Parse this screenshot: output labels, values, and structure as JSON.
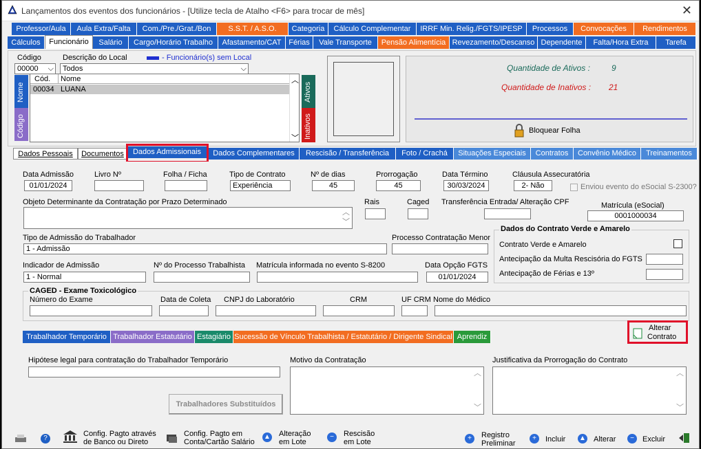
{
  "window": {
    "title": "Lançamentos dos eventos dos funcionários - [Utilize tecla de Atalho <F6> para trocar de mês]",
    "close": "✕"
  },
  "tabs_row1": [
    {
      "label": "Professor/Aula",
      "color": "#1f5fc4"
    },
    {
      "label": "Aula Extra/Falta",
      "color": "#1f5fc4"
    },
    {
      "label": "Com./Pre./Grat./Bon",
      "color": "#1f5fc4"
    },
    {
      "label": "S.S.T. / A.S.O.",
      "color": "#f26d21"
    },
    {
      "label": "Categoria",
      "color": "#1f5fc4"
    },
    {
      "label": "Cálculo Complementar",
      "color": "#1f5fc4"
    },
    {
      "label": "IRRF Min. Relig./FGTS/IPESP",
      "color": "#1f5fc4"
    },
    {
      "label": "Processos",
      "color": "#1f5fc4"
    },
    {
      "label": "Convocações",
      "color": "#f26d21"
    },
    {
      "label": "Rendimentos",
      "color": "#f26d21"
    }
  ],
  "tabs_row2": [
    {
      "label": "Cálculos",
      "color": "#1f5fc4"
    },
    {
      "label": "Funcionário",
      "color": "#1f5fc4"
    },
    {
      "label": "Salário",
      "color": "#1f5fc4"
    },
    {
      "label": "Cargo/Horário Trabalho",
      "color": "#1f5fc4"
    },
    {
      "label": "Afastamento/CAT",
      "color": "#1f5fc4"
    },
    {
      "label": "Férias",
      "color": "#1f5fc4"
    },
    {
      "label": "Vale Transporte",
      "color": "#1f5fc4"
    },
    {
      "label": "Pensão Alimentícia",
      "color": "#f26d21"
    },
    {
      "label": "Revezamento/Descanso",
      "color": "#1f5fc4"
    },
    {
      "label": "Dependente",
      "color": "#1f5fc4"
    },
    {
      "label": "Falta/Hora Extra",
      "color": "#1f5fc4"
    },
    {
      "label": "Tarefa",
      "color": "#1f5fc4"
    }
  ],
  "filter": {
    "codigo_label": "Código",
    "codigo_value": "00000",
    "descricao_label": "Descrição do Local",
    "descricao_value": "Todos",
    "legend": "- Funcionário(s) sem Local"
  },
  "list": {
    "side_nome": "Nome",
    "side_codigo": "Código",
    "col_cod": "Cód.",
    "col_nome": "Nome",
    "rows": [
      {
        "cod": "00034",
        "nome": "LUANA"
      }
    ],
    "ativos": "Ativos",
    "inativos": "Inativos"
  },
  "stats": {
    "ativos_label": "Quantidade de Ativos :",
    "ativos_value": "9",
    "inativos_label": "Quantidade de Inativos :",
    "inativos_value": "21",
    "bloquear": "Bloquear Folha"
  },
  "subtabs": [
    {
      "label": "Dados Pessoais"
    },
    {
      "label": "Documentos"
    },
    {
      "label": "Dados Admissionais"
    },
    {
      "label": "Dados Complementares"
    },
    {
      "label": "Rescisão / Transferência"
    },
    {
      "label": "Foto / Crachá"
    },
    {
      "label": "Situações Especiais"
    },
    {
      "label": "Contratos"
    },
    {
      "label": "Convênio Médico"
    },
    {
      "label": "Treinamentos"
    }
  ],
  "form": {
    "data_admissao_label": "Data Admissão",
    "data_admissao": "01/01/2024",
    "livro_label": "Livro Nº",
    "livro": "",
    "folha_label": "Folha / Ficha",
    "folha": "",
    "tipo_contrato_label": "Tipo de Contrato",
    "tipo_contrato": "Experiência",
    "dias_label": "Nº de dias",
    "dias": "45",
    "prorrogacao_label": "Prorrogação",
    "prorrogacao": "45",
    "data_termino_label": "Data Término",
    "data_termino": "30/03/2024",
    "clausula_label": "Cláusula Assecuratória",
    "clausula": "2- Não",
    "esocial_check": "Enviou evento do eSocial S-2300?",
    "objeto_label": "Objeto Determinante da Contratação por Prazo Determinado",
    "rais_label": "Rais",
    "caged_label": "Caged",
    "transferencia_label": "Transferência Entrada/ Alteração CPF",
    "matricula_label": "Matrícula (eSocial)",
    "matricula": "0001000034",
    "tipo_admissao_label": "Tipo de Admissão do Trabalhador",
    "tipo_admissao": "1 - Admissão",
    "processo_label": "Processo Contratação Menor",
    "verde_title": "Dados do Contrato Verde e Amarelo",
    "verde_check": "Contrato Verde e Amarelo",
    "antecip_multa": "Antecipação da Multa Rescisória do FGTS",
    "antecip_ferias": "Antecipação de Férias e 13º",
    "indicador_label": "Indicador de Admissão",
    "indicador": "1 - Normal",
    "num_processo_label": "Nº do Processo Trabalhista",
    "matricula_s8200_label": "Matrícula informada no evento S-8200",
    "data_fgts_label": "Data Opção FGTS",
    "data_fgts": "01/01/2024",
    "caged_title": "CAGED - Exame Toxicológico",
    "numero_exame": "Número do Exame",
    "data_coleta": "Data de Coleta",
    "cnpj_lab": "CNPJ do Laboratório",
    "crm": "CRM",
    "uf_crm": "UF CRM",
    "nome_medico": "Nome do Médico"
  },
  "tabs3": [
    {
      "label": "Trabalhador Temporário",
      "color": "#1f5fc4"
    },
    {
      "label": "Trabalhador Estatutário",
      "color": "#8a6cc8"
    },
    {
      "label": "Estagiário",
      "color": "#1a8a6a"
    },
    {
      "label": "Sucessão de Vínculo Trabalhista / Estatutário / Dirigente Sindical",
      "color": "#f26d21"
    },
    {
      "label": "Aprendiz",
      "color": "#2a9a3a"
    }
  ],
  "alterar_contrato": {
    "line1": "Alterar",
    "line2": "Contrato"
  },
  "temp": {
    "hipotese": "Hipótese legal para contratação do Trabalhador Temporário",
    "motivo": "Motivo da Contratação",
    "justificativa": "Justificativa da Prorrogação do Contrato",
    "substituidos": "Trabalhadores Substituídos"
  },
  "bottom": {
    "cfg_banco1": "Config. Pagto através",
    "cfg_banco2": "de Banco ou Direto",
    "cfg_conta1": "Config. Pagto em",
    "cfg_conta2": "Conta/Cartão Salário",
    "alt_lote1": "Alteração",
    "alt_lote2": "em Lote",
    "resc_lote1": "Rescisão",
    "resc_lote2": "em Lote",
    "reg_prel1": "Registro",
    "reg_prel2": "Preliminar",
    "incluir": "Incluir",
    "alterar": "Alterar",
    "excluir": "Excluir"
  },
  "colors": {
    "accent": "#1f5fc4",
    "orange": "#f26d21",
    "red_highlight": "#e0102a",
    "stat_green": "#1a6a5a",
    "stat_red": "#d01a1a"
  }
}
